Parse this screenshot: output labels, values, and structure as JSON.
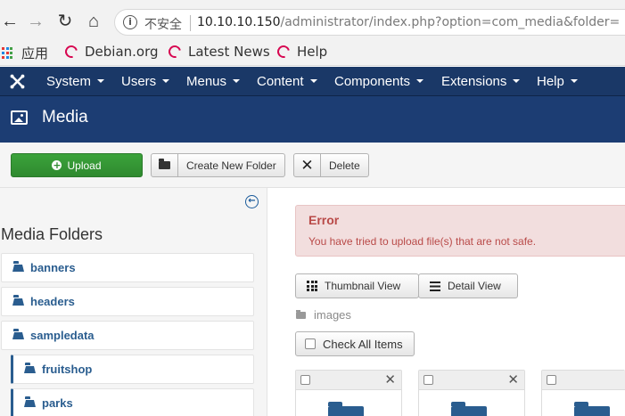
{
  "browser": {
    "security_label": "不安全",
    "url_host": "10.10.10.150",
    "url_path": "/administrator/index.php?option=com_media&folder=",
    "bookmarks": [
      {
        "label": "应用"
      },
      {
        "label": "Debian.org"
      },
      {
        "label": "Latest News"
      },
      {
        "label": "Help"
      }
    ]
  },
  "admin_menu": [
    {
      "label": "System"
    },
    {
      "label": "Users"
    },
    {
      "label": "Menus"
    },
    {
      "label": "Content"
    },
    {
      "label": "Components"
    },
    {
      "label": "Extensions"
    },
    {
      "label": "Help"
    }
  ],
  "page": {
    "title": "Media"
  },
  "toolbar": {
    "upload_label": "Upload",
    "create_folder_label": "Create New Folder",
    "delete_label": "Delete"
  },
  "sidebar": {
    "heading": "Media Folders",
    "folders": [
      {
        "label": "banners"
      },
      {
        "label": "headers"
      },
      {
        "label": "sampledata"
      },
      {
        "label": "fruitshop"
      },
      {
        "label": "parks"
      }
    ]
  },
  "alert": {
    "heading": "Error",
    "message": "You have tried to upload file(s) that are not safe."
  },
  "views": {
    "thumbnail_label": "Thumbnail View",
    "detail_label": "Detail View"
  },
  "breadcrumb": {
    "current": "images"
  },
  "check_all_label": "Check All Items",
  "colors": {
    "nav_bg": "#1a3867",
    "title_bg": "#1c3d73",
    "success": "#2f8a2f",
    "link": "#2a5d8f",
    "error_bg": "#f2dede",
    "error_text": "#b94a48"
  }
}
